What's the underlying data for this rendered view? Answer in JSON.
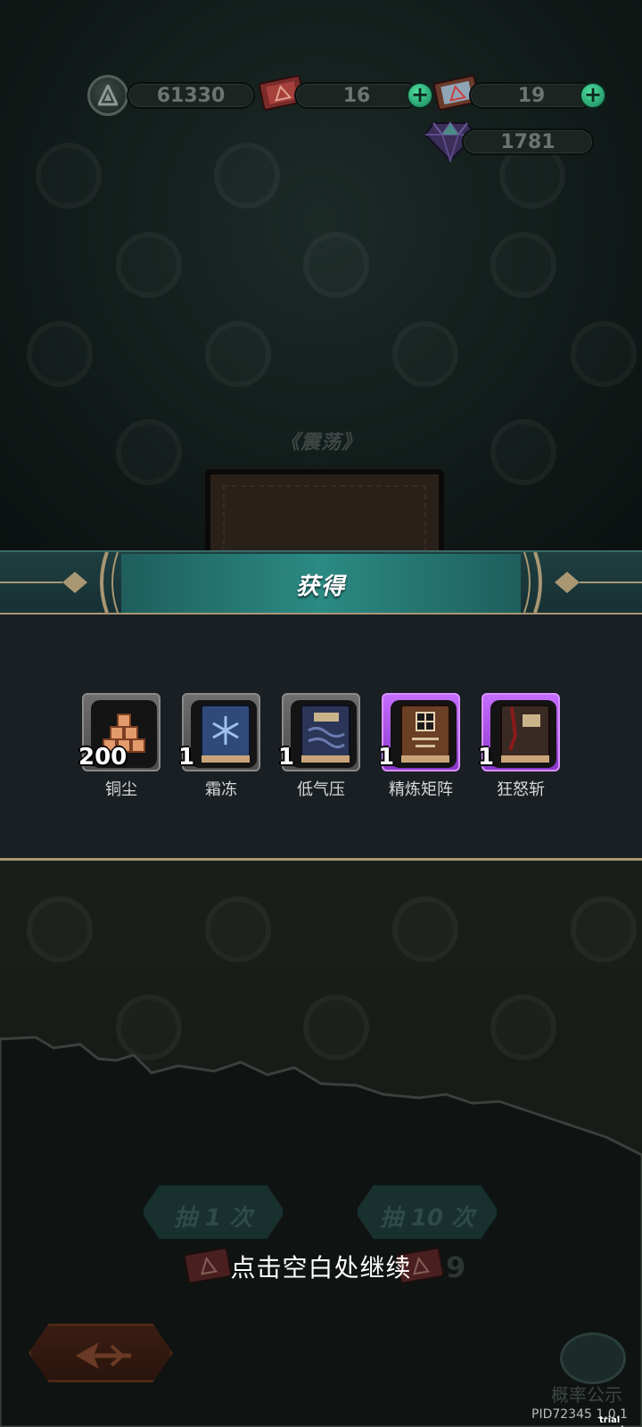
{
  "currencies": {
    "coins": "61330",
    "ticket_red": "16",
    "ticket_blue": "19",
    "gems": "1781"
  },
  "preview_item": {
    "title": "《震荡》"
  },
  "reward_panel": {
    "title": "获得",
    "items": [
      {
        "count": "200",
        "name": "铜尘",
        "rarity": "grey",
        "icon": "copper-dust-icon"
      },
      {
        "count": "1",
        "name": "霜冻",
        "rarity": "grey",
        "icon": "frost-book-icon"
      },
      {
        "count": "1",
        "name": "低气压",
        "rarity": "grey",
        "icon": "low-pressure-book-icon"
      },
      {
        "count": "1",
        "name": "精炼矩阵",
        "rarity": "purple",
        "icon": "refine-matrix-book-icon"
      },
      {
        "count": "1",
        "name": "狂怒斩",
        "rarity": "purple",
        "icon": "rage-slash-book-icon"
      }
    ]
  },
  "draw_buttons": {
    "single_label": "抽 1 次",
    "ten_label": "抽 10 次",
    "ten_cost": "9"
  },
  "continue_hint": "点击空白处继续",
  "probability_label": "概率公示",
  "version": "PID72345 1.0.1",
  "trial": "trial version",
  "colors": {
    "rare_purple": "#b455f5",
    "common_grey": "#6e6e6e",
    "banner_teal": "#2b8a83",
    "plus_green": "#2fbf7f"
  }
}
